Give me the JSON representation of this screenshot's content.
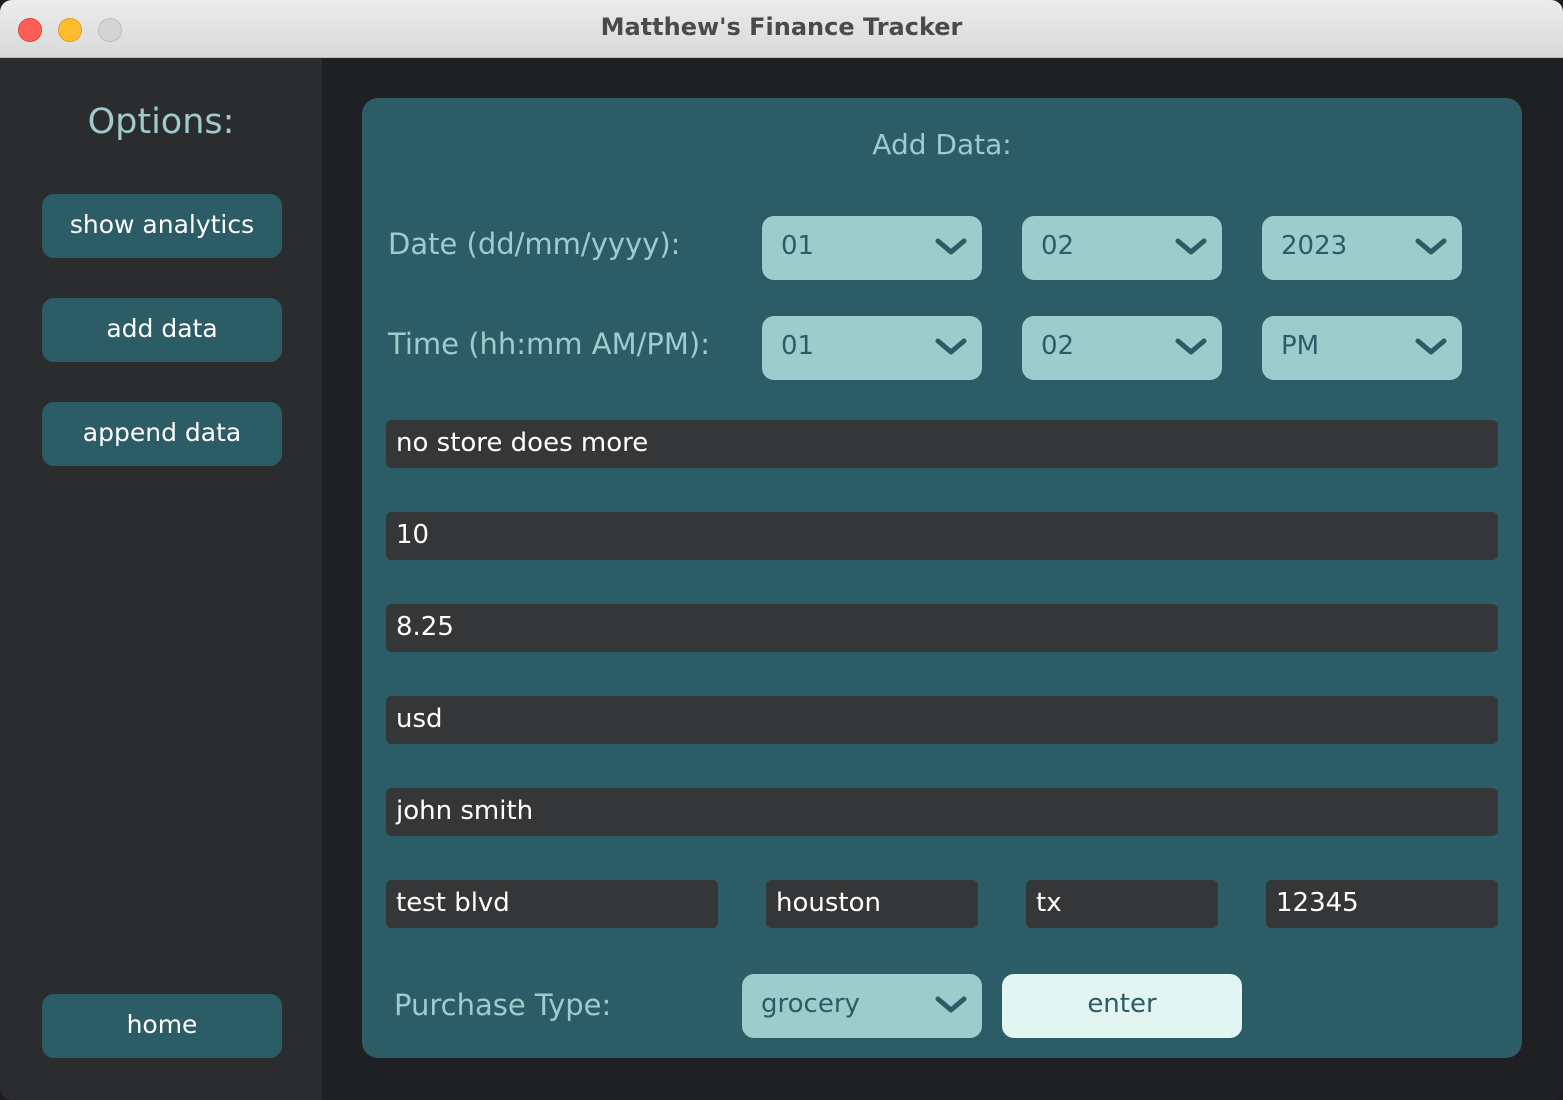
{
  "window": {
    "title": "Matthew's Finance Tracker"
  },
  "sidebar": {
    "title": "Options:",
    "items": [
      {
        "label": "show analytics"
      },
      {
        "label": "add data"
      },
      {
        "label": "append data"
      }
    ],
    "home_label": "home"
  },
  "form": {
    "title": "Add Data:",
    "date_label": "Date (dd/mm/yyyy):",
    "date": {
      "day": "01",
      "month": "02",
      "year": "2023"
    },
    "time_label": "Time (hh:mm AM/PM):",
    "time": {
      "hour": "01",
      "minute": "02",
      "ampm": "PM"
    },
    "fields": {
      "store": "no store does more",
      "quantity": "10",
      "amount": "8.25",
      "currency": "usd",
      "name": "john smith",
      "street": "test blvd",
      "city": "houston",
      "state": "tx",
      "zip": "12345"
    },
    "purchase_type_label": "Purchase Type:",
    "purchase_type": "grocery",
    "enter_label": "enter"
  },
  "colors": {
    "accent": "#2c5c66",
    "dropdown": "#9ecbcb",
    "field_bg": "#343638",
    "enter_bg": "#e3f5f1"
  },
  "icons": {
    "dropdown": "chevron-down-icon"
  }
}
